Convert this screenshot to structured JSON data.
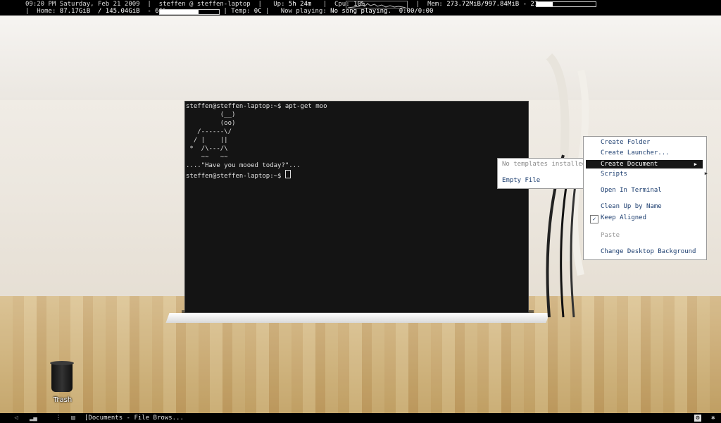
{
  "statusbar": {
    "line1": {
      "time": "09:20 PM",
      "date": "Saturday, Feb 21 2009",
      "user_host": "steffen @ steffen-laptop",
      "uptime_label": "Up:",
      "uptime": "5h 24m",
      "cpu_label": "Cpu:",
      "cpu": "10%",
      "mem_label": "Mem:",
      "mem": "273.72MiB/997.84MiB - 27%",
      "mem_percent": 27
    },
    "line2": {
      "home_label": "Home:",
      "home": "87.17GiB  / 145.04GiB  - 66%",
      "home_percent": 66,
      "temp_label": "Temp:",
      "temp": "0C",
      "now_playing_label": "Now playing:",
      "now_playing": "No song playing.  0:00/0:00"
    }
  },
  "terminal": {
    "lines": [
      "steffen@steffen-laptop:~$ apt-get moo",
      "         (__)",
      "         (oo)",
      "   /------\\/",
      "  / |    ||",
      " *  /\\---/\\",
      "    ~~   ~~",
      "....\"Have you mooed today?\"...",
      "steffen@steffen-laptop:~$ "
    ]
  },
  "context_menu": {
    "items": [
      {
        "label": "Create Folder"
      },
      {
        "label": "Create Launcher..."
      },
      {
        "label": "Create Document",
        "submenu": true
      },
      {
        "label": "Scripts",
        "submenu": true
      },
      {
        "label": "Open In Terminal"
      },
      {
        "label": "Clean Up by Name"
      },
      {
        "label": "Keep Aligned",
        "checked": true
      },
      {
        "label": "Paste",
        "disabled": true
      },
      {
        "label": "Change Desktop Background"
      }
    ]
  },
  "submenu": {
    "header": "No templates installed",
    "item": "Empty File"
  },
  "desktop": {
    "trash_label": "Trash"
  },
  "taskbar": {
    "task": "[Documents - File Brows..."
  }
}
